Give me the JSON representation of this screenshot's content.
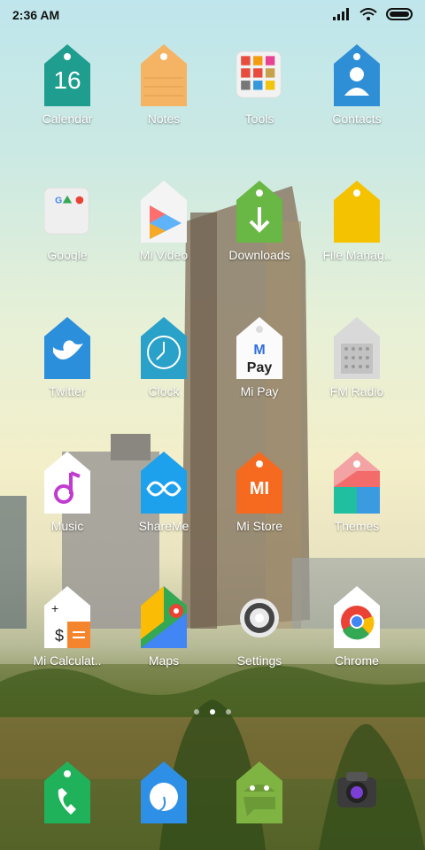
{
  "status": {
    "time": "2:36 AM"
  },
  "colors": {
    "label": "#ffffff"
  },
  "apps": [
    {
      "name": "calendar",
      "label": "Calendar",
      "icon": "calendar-icon",
      "text": "16"
    },
    {
      "name": "notes",
      "label": "Notes",
      "icon": "notes-icon"
    },
    {
      "name": "tools",
      "label": "Tools",
      "icon": "tools-folder-icon"
    },
    {
      "name": "contacts",
      "label": "Contacts",
      "icon": "contacts-icon"
    },
    {
      "name": "google",
      "label": "Google",
      "icon": "google-folder-icon"
    },
    {
      "name": "mi-video",
      "label": "Mi Video",
      "icon": "mi-video-icon"
    },
    {
      "name": "downloads",
      "label": "Downloads",
      "icon": "downloads-icon"
    },
    {
      "name": "file-manager",
      "label": "File Manag..",
      "icon": "file-manager-icon"
    },
    {
      "name": "twitter",
      "label": "Twitter",
      "icon": "twitter-icon"
    },
    {
      "name": "clock",
      "label": "Clock",
      "icon": "clock-icon"
    },
    {
      "name": "mi-pay",
      "label": "Mi Pay",
      "icon": "mi-pay-icon",
      "text": "Pay"
    },
    {
      "name": "fm-radio",
      "label": "FM Radio",
      "icon": "fm-radio-icon"
    },
    {
      "name": "music",
      "label": "Music",
      "icon": "music-icon"
    },
    {
      "name": "shareme",
      "label": "ShareMe",
      "icon": "shareme-icon"
    },
    {
      "name": "mi-store",
      "label": "Mi Store",
      "icon": "mi-store-icon",
      "text": "MI"
    },
    {
      "name": "themes",
      "label": "Themes",
      "icon": "themes-icon"
    },
    {
      "name": "mi-calculator",
      "label": "Mi Calculat..",
      "icon": "calculator-icon"
    },
    {
      "name": "maps",
      "label": "Maps",
      "icon": "maps-icon"
    },
    {
      "name": "settings",
      "label": "Settings",
      "icon": "settings-icon"
    },
    {
      "name": "chrome",
      "label": "Chrome",
      "icon": "chrome-icon"
    }
  ],
  "dock": [
    {
      "name": "phone",
      "icon": "phone-icon"
    },
    {
      "name": "messages",
      "icon": "messages-icon"
    },
    {
      "name": "android-messages",
      "icon": "android-icon"
    },
    {
      "name": "camera",
      "icon": "camera-icon"
    }
  ],
  "pager": {
    "pages": 3,
    "active": 2
  }
}
